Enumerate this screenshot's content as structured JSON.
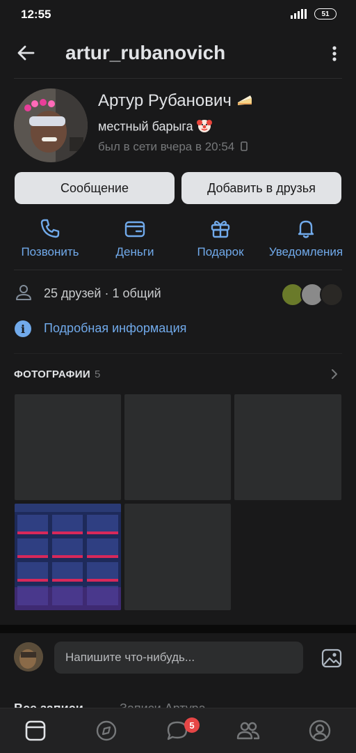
{
  "status_bar": {
    "time": "12:55",
    "battery": "51"
  },
  "header": {
    "title": "artur_rubanovich"
  },
  "profile": {
    "name": "Артур Рубанович",
    "status": "местный барыга",
    "last_seen": "был в сети вчера в 20:54"
  },
  "buttons": {
    "message": "Сообщение",
    "add_friend": "Добавить в друзья"
  },
  "actions": [
    {
      "label": "Позвонить",
      "icon": "phone-icon"
    },
    {
      "label": "Деньги",
      "icon": "wallet-icon"
    },
    {
      "label": "Подарок",
      "icon": "gift-icon"
    },
    {
      "label": "Уведомления",
      "icon": "bell-icon"
    }
  ],
  "friends": {
    "text": "25 друзей · 1 общий"
  },
  "info": {
    "text": "Подробная информация"
  },
  "photos": {
    "title": "ФОТОГРАФИИ",
    "count": "5"
  },
  "composer": {
    "placeholder": "Напишите что-нибудь..."
  },
  "posts": {
    "tab_all": "Все записи",
    "tab_user": "Записи Артура"
  },
  "tabbar": {
    "messages_badge": "5"
  },
  "colors": {
    "accent": "#71aaeb",
    "background": "#19191a",
    "card": "#2c2d2e",
    "badge": "#e64646"
  }
}
